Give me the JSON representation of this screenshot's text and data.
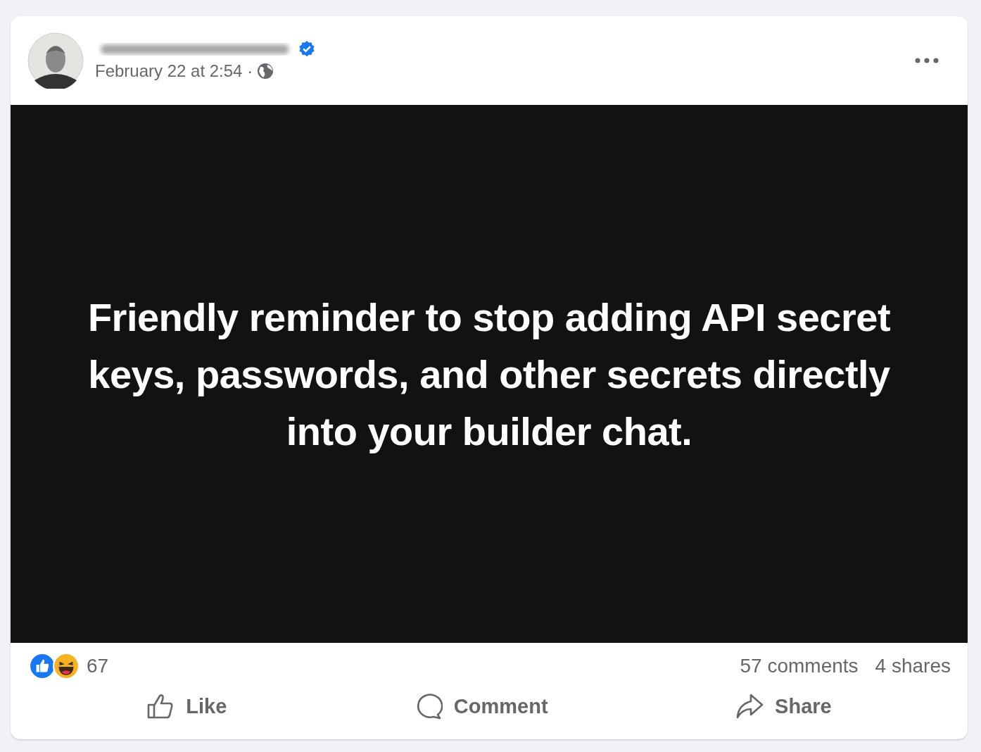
{
  "post": {
    "author": {
      "verified": true
    },
    "timestamp": "February 22 at 2:54 ·",
    "image_text": "Friendly reminder to stop adding API secret keys, passwords, and other secrets directly into your builder chat.",
    "reactions": {
      "icons": [
        {
          "kind": "like"
        },
        {
          "kind": "haha"
        }
      ],
      "count": "67"
    },
    "comments": "57 comments",
    "shares": "4 shares",
    "actions": [
      {
        "kind": "like",
        "label": "Like"
      },
      {
        "kind": "comment",
        "label": "Comment"
      },
      {
        "kind": "share",
        "label": "Share"
      }
    ]
  }
}
